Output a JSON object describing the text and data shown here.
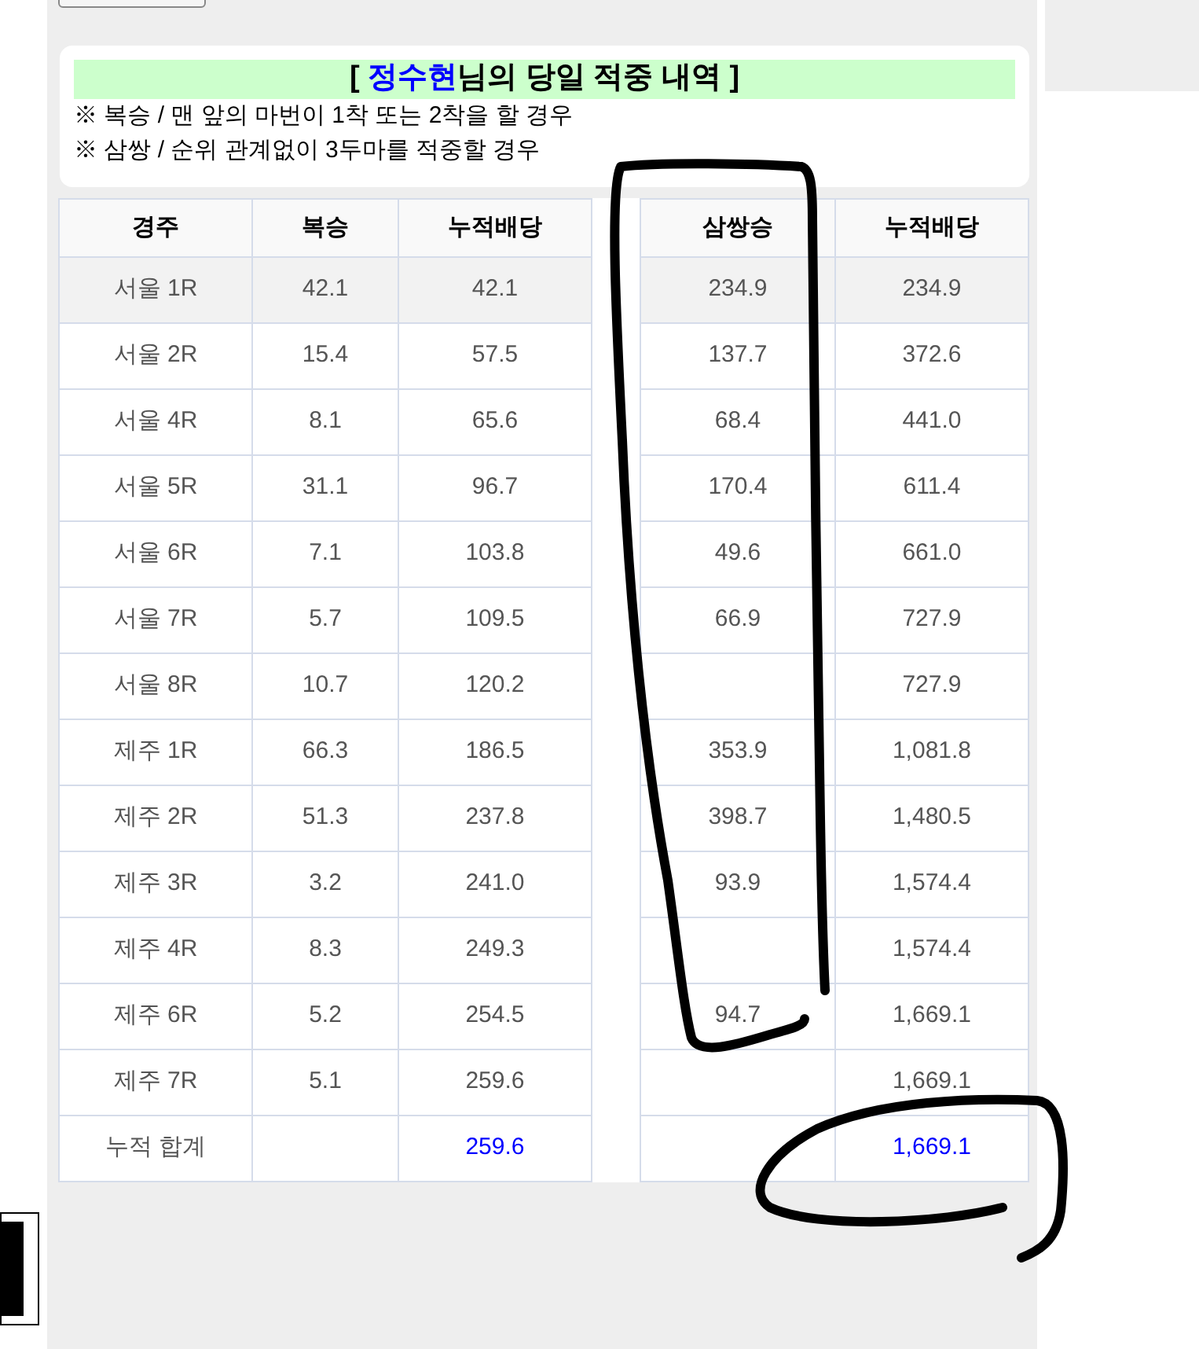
{
  "title": {
    "open": "[",
    "name": "정수현",
    "rest": "님의 당일 적중 내역 ]"
  },
  "notes": [
    "※ 복승 / 맨 앞의 마번이 1착 또는 2착을 할 경우",
    "※ 삼쌍 / 순위 관계없이 3두마를 적중할 경우"
  ],
  "columns_left": [
    "경주",
    "복승",
    "누적배당"
  ],
  "columns_right": [
    "삼쌍승",
    "누적배당"
  ],
  "rows": [
    {
      "race": "서울 1R",
      "quinella": "42.1",
      "cum_quinella": "42.1",
      "trifecta": "234.9",
      "cum_trifecta": "234.9",
      "highlighted": true
    },
    {
      "race": "서울 2R",
      "quinella": "15.4",
      "cum_quinella": "57.5",
      "trifecta": "137.7",
      "cum_trifecta": "372.6",
      "highlighted": false
    },
    {
      "race": "서울 4R",
      "quinella": "8.1",
      "cum_quinella": "65.6",
      "trifecta": "68.4",
      "cum_trifecta": "441.0",
      "highlighted": false
    },
    {
      "race": "서울 5R",
      "quinella": "31.1",
      "cum_quinella": "96.7",
      "trifecta": "170.4",
      "cum_trifecta": "611.4",
      "highlighted": false
    },
    {
      "race": "서울 6R",
      "quinella": "7.1",
      "cum_quinella": "103.8",
      "trifecta": "49.6",
      "cum_trifecta": "661.0",
      "highlighted": false
    },
    {
      "race": "서울 7R",
      "quinella": "5.7",
      "cum_quinella": "109.5",
      "trifecta": "66.9",
      "cum_trifecta": "727.9",
      "highlighted": false
    },
    {
      "race": "서울 8R",
      "quinella": "10.7",
      "cum_quinella": "120.2",
      "cum_trifecta": "727.9",
      "highlighted": false
    },
    {
      "race": "제주 1R",
      "quinella": "66.3",
      "cum_quinella": "186.5",
      "trifecta": "353.9",
      "cum_trifecta": "1,081.8",
      "highlighted": false
    },
    {
      "race": "제주 2R",
      "quinella": "51.3",
      "cum_quinella": "237.8",
      "trifecta": "398.7",
      "cum_trifecta": "1,480.5",
      "highlighted": false
    },
    {
      "race": "제주 3R",
      "quinella": "3.2",
      "cum_quinella": "241.0",
      "trifecta": "93.9",
      "cum_trifecta": "1,574.4",
      "highlighted": false
    },
    {
      "race": "제주 4R",
      "quinella": "8.3",
      "cum_quinella": "249.3",
      "cum_trifecta": "1,574.4",
      "highlighted": false
    },
    {
      "race": "제주 6R",
      "quinella": "5.2",
      "cum_quinella": "254.5",
      "trifecta": "94.7",
      "cum_trifecta": "1,669.1",
      "highlighted": false
    },
    {
      "race": "제주 7R",
      "quinella": "5.1",
      "cum_quinella": "259.6",
      "cum_trifecta": "1,669.1",
      "highlighted": false
    }
  ],
  "total": {
    "label": "누적 합계",
    "cum_quinella": "259.6",
    "cum_trifecta": "1,669.1"
  }
}
